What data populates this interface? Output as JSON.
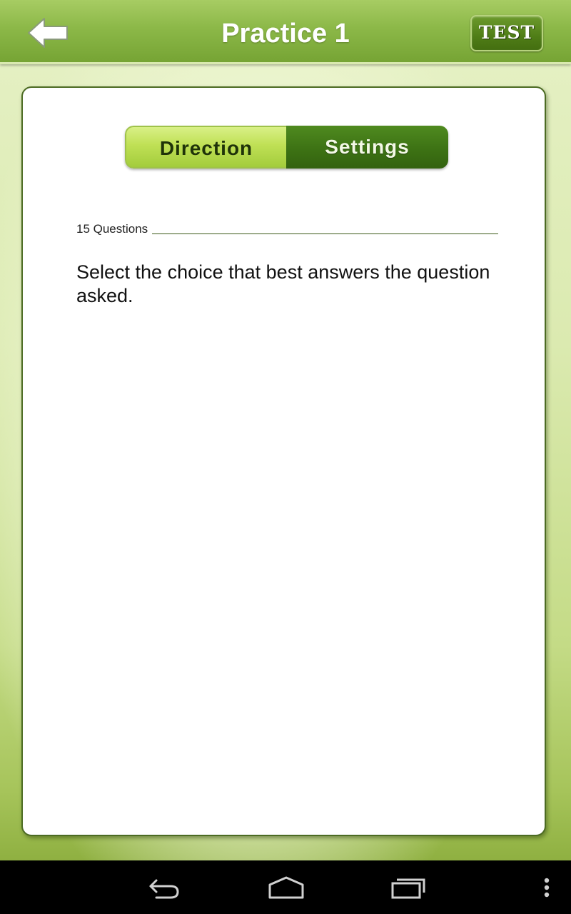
{
  "header": {
    "title": "Practice 1",
    "test_label": "TEST",
    "back_icon": "arrow-left-icon"
  },
  "tabs": [
    {
      "label": "Direction",
      "active": true
    },
    {
      "label": "Settings",
      "active": false
    }
  ],
  "content": {
    "question_count": "15 Questions",
    "direction_text": "Select the choice that best answers the question asked."
  },
  "navbar": {
    "icons": [
      "back-icon",
      "home-icon",
      "recent-apps-icon",
      "overflow-menu-icon"
    ]
  },
  "colors": {
    "header_green": "#8cb848",
    "active_tab": "#bfe055",
    "inactive_tab": "#3d7214",
    "card_border": "#4c6b23"
  }
}
